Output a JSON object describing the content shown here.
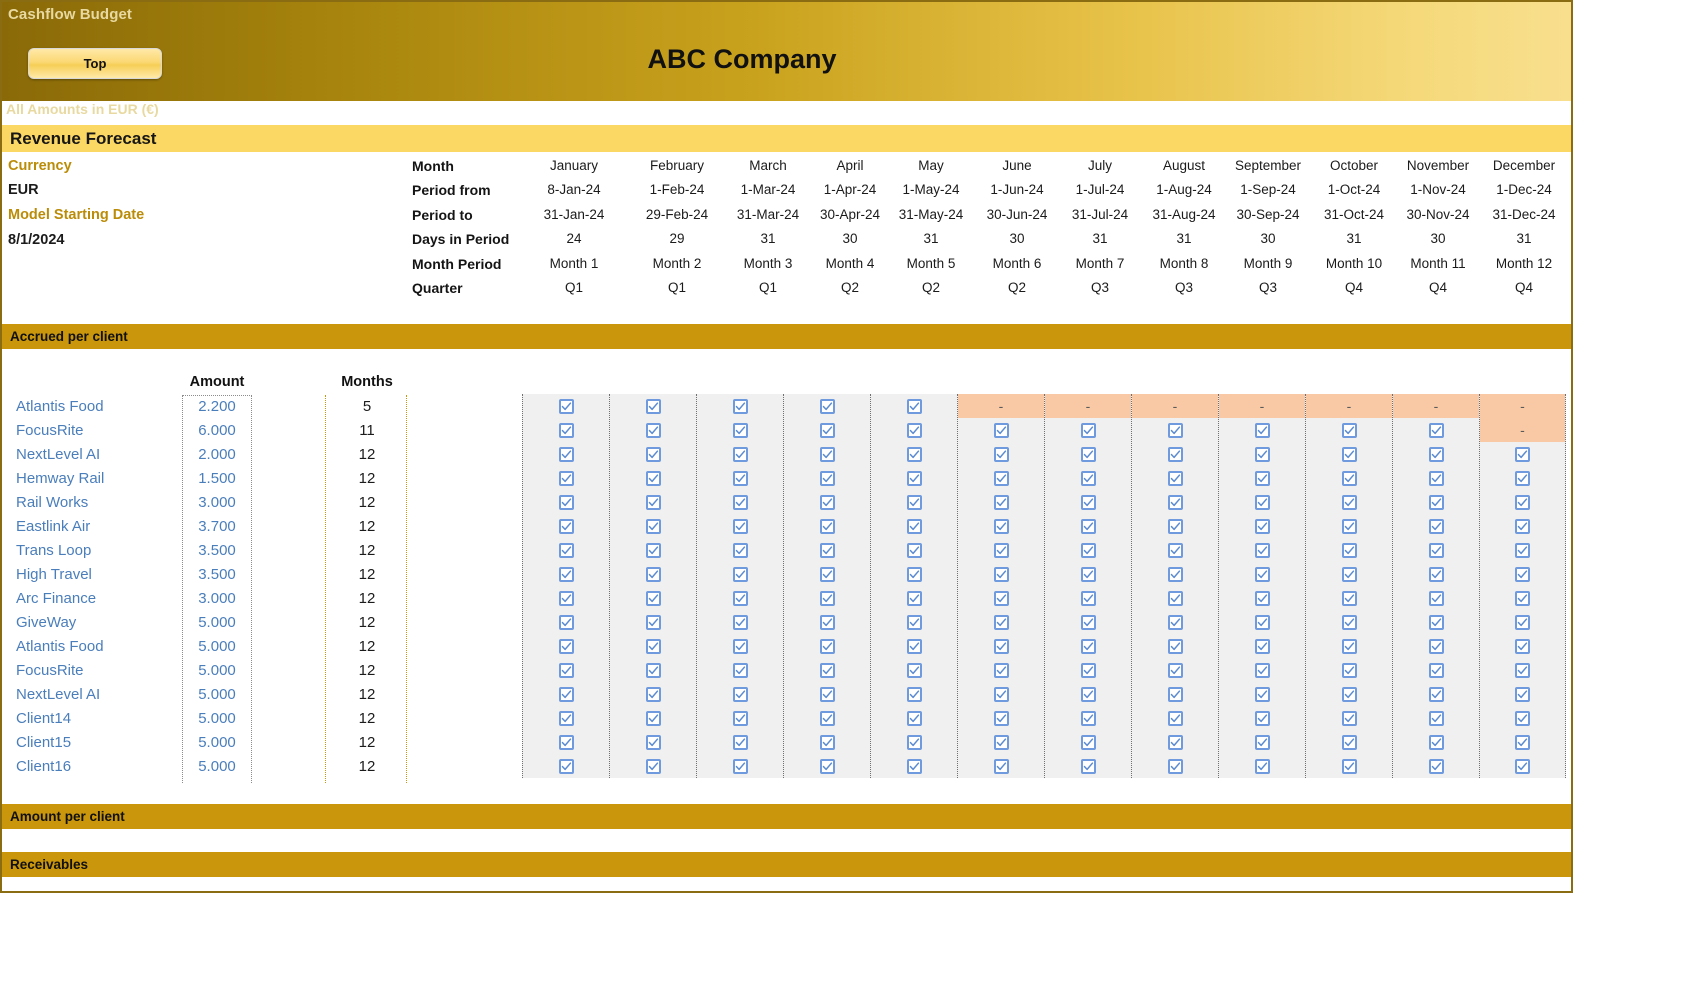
{
  "window": {
    "banner_title": "Cashflow Budget",
    "company_name": "ABC Company",
    "top_button_label": "Top",
    "amounts_note": "All Amounts in  EUR (€)"
  },
  "sections": {
    "revenue_forecast": "Revenue Forecast",
    "accrued_per_client": "Accrued per client",
    "amount_per_client": "Amount per client",
    "receivables": "Receivables"
  },
  "meta": {
    "currency_label": "Currency",
    "currency_value": "EUR",
    "start_date_label": "Model Starting Date",
    "start_date_value": "8/1/2024"
  },
  "month_header": {
    "row_labels": [
      "Month",
      "Period from",
      "Period to",
      "Days in Period",
      "Month Period",
      "Quarter"
    ],
    "months": [
      "January",
      "February",
      "March",
      "April",
      "May",
      "June",
      "July",
      "August",
      "September",
      "October",
      "November",
      "December"
    ],
    "period_from": [
      "8-Jan-24",
      "1-Feb-24",
      "1-Mar-24",
      "1-Apr-24",
      "1-May-24",
      "1-Jun-24",
      "1-Jul-24",
      "1-Aug-24",
      "1-Sep-24",
      "1-Oct-24",
      "1-Nov-24",
      "1-Dec-24"
    ],
    "period_to": [
      "31-Jan-24",
      "29-Feb-24",
      "31-Mar-24",
      "30-Apr-24",
      "31-May-24",
      "30-Jun-24",
      "31-Jul-24",
      "31-Aug-24",
      "30-Sep-24",
      "31-Oct-24",
      "30-Nov-24",
      "31-Dec-24"
    ],
    "days_in_period": [
      "24",
      "29",
      "31",
      "30",
      "31",
      "30",
      "31",
      "31",
      "30",
      "31",
      "30",
      "31"
    ],
    "month_period": [
      "Month 1",
      "Month 2",
      "Month 3",
      "Month 4",
      "Month 5",
      "Month 6",
      "Month 7",
      "Month 8",
      "Month 9",
      "Month 10",
      "Month 11",
      "Month 12"
    ],
    "quarter": [
      "Q1",
      "Q1",
      "Q1",
      "Q2",
      "Q2",
      "Q2",
      "Q3",
      "Q3",
      "Q3",
      "Q4",
      "Q4",
      "Q4"
    ]
  },
  "client_table": {
    "columns": [
      "Amount",
      "Months"
    ],
    "rows": [
      {
        "name": "Atlantis Food",
        "amount": "2.200",
        "months": "5",
        "checks": [
          true,
          true,
          true,
          true,
          true,
          false,
          false,
          false,
          false,
          false,
          false,
          false
        ]
      },
      {
        "name": "FocusRite",
        "amount": "6.000",
        "months": "11",
        "checks": [
          true,
          true,
          true,
          true,
          true,
          true,
          true,
          true,
          true,
          true,
          true,
          false
        ]
      },
      {
        "name": "NextLevel AI",
        "amount": "2.000",
        "months": "12",
        "checks": [
          true,
          true,
          true,
          true,
          true,
          true,
          true,
          true,
          true,
          true,
          true,
          true
        ]
      },
      {
        "name": "Hemway Rail",
        "amount": "1.500",
        "months": "12",
        "checks": [
          true,
          true,
          true,
          true,
          true,
          true,
          true,
          true,
          true,
          true,
          true,
          true
        ]
      },
      {
        "name": "Rail Works",
        "amount": "3.000",
        "months": "12",
        "checks": [
          true,
          true,
          true,
          true,
          true,
          true,
          true,
          true,
          true,
          true,
          true,
          true
        ]
      },
      {
        "name": "Eastlink Air",
        "amount": "3.700",
        "months": "12",
        "checks": [
          true,
          true,
          true,
          true,
          true,
          true,
          true,
          true,
          true,
          true,
          true,
          true
        ]
      },
      {
        "name": "Trans Loop",
        "amount": "3.500",
        "months": "12",
        "checks": [
          true,
          true,
          true,
          true,
          true,
          true,
          true,
          true,
          true,
          true,
          true,
          true
        ]
      },
      {
        "name": "High Travel",
        "amount": "3.500",
        "months": "12",
        "checks": [
          true,
          true,
          true,
          true,
          true,
          true,
          true,
          true,
          true,
          true,
          true,
          true
        ]
      },
      {
        "name": "Arc Finance",
        "amount": "3.000",
        "months": "12",
        "checks": [
          true,
          true,
          true,
          true,
          true,
          true,
          true,
          true,
          true,
          true,
          true,
          true
        ]
      },
      {
        "name": "GiveWay",
        "amount": "5.000",
        "months": "12",
        "checks": [
          true,
          true,
          true,
          true,
          true,
          true,
          true,
          true,
          true,
          true,
          true,
          true
        ]
      },
      {
        "name": "Atlantis Food",
        "amount": "5.000",
        "months": "12",
        "checks": [
          true,
          true,
          true,
          true,
          true,
          true,
          true,
          true,
          true,
          true,
          true,
          true
        ]
      },
      {
        "name": "FocusRite",
        "amount": "5.000",
        "months": "12",
        "checks": [
          true,
          true,
          true,
          true,
          true,
          true,
          true,
          true,
          true,
          true,
          true,
          true
        ]
      },
      {
        "name": "NextLevel AI",
        "amount": "5.000",
        "months": "12",
        "checks": [
          true,
          true,
          true,
          true,
          true,
          true,
          true,
          true,
          true,
          true,
          true,
          true
        ]
      },
      {
        "name": "Client14",
        "amount": "5.000",
        "months": "12",
        "checks": [
          true,
          true,
          true,
          true,
          true,
          true,
          true,
          true,
          true,
          true,
          true,
          true
        ]
      },
      {
        "name": "Client15",
        "amount": "5.000",
        "months": "12",
        "checks": [
          true,
          true,
          true,
          true,
          true,
          true,
          true,
          true,
          true,
          true,
          true,
          true
        ]
      },
      {
        "name": "Client16",
        "amount": "5.000",
        "months": "12",
        "checks": [
          true,
          true,
          true,
          true,
          true,
          true,
          true,
          true,
          true,
          true,
          true,
          true
        ]
      }
    ],
    "off_marker": "-"
  },
  "colors": {
    "band_gold": "#c9960c",
    "band_yellow": "#fbd863",
    "input_blue": "#4a7ebb",
    "off_peach": "#f8c9a4",
    "grid_gray": "#f0f0f0",
    "label_gold": "#bb8c08",
    "checkbox_blue": "#6f9ade"
  }
}
